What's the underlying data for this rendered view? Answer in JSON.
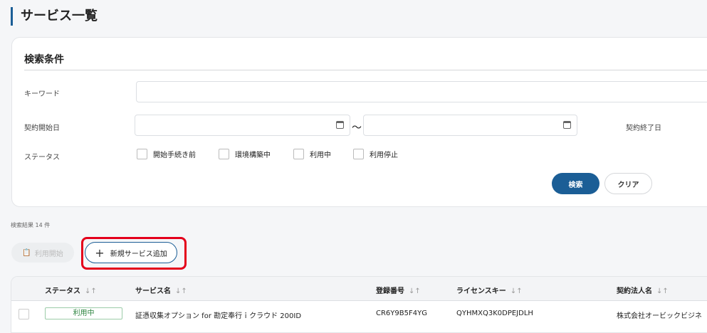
{
  "page_title": "サービス一覧",
  "search": {
    "heading": "検索条件",
    "keyword_label": "キーワード",
    "keyword_value": "",
    "start_date_label": "契約開始日",
    "date_from": "",
    "date_to": "",
    "range_sep": "～",
    "end_date_label": "契約終了日",
    "status_label": "ステータス",
    "statuses": [
      "開始手続き前",
      "環境構築中",
      "利用中",
      "利用停止"
    ],
    "search_button": "検索",
    "clear_button": "クリア"
  },
  "result_count": "検索結果 14 件",
  "actions": {
    "start_button": "利用開始",
    "add_button": "新規サービス追加"
  },
  "table": {
    "columns": [
      "ステータス",
      "サービス名",
      "登録番号",
      "ライセンスキー",
      "契約法人名"
    ],
    "rows": [
      {
        "status": "利用中",
        "service": "証憑収集オプション for 勘定奉行ｉクラウド 200ID",
        "reg_no": "CR6Y9B5F4YG",
        "license": "QYHMXQ3K0DPEJDLH",
        "company": "株式会社オービックビジネ"
      }
    ]
  },
  "colors": {
    "primary": "#1b5e96",
    "highlight": "#e4001b",
    "status_active": "#2e8540"
  }
}
